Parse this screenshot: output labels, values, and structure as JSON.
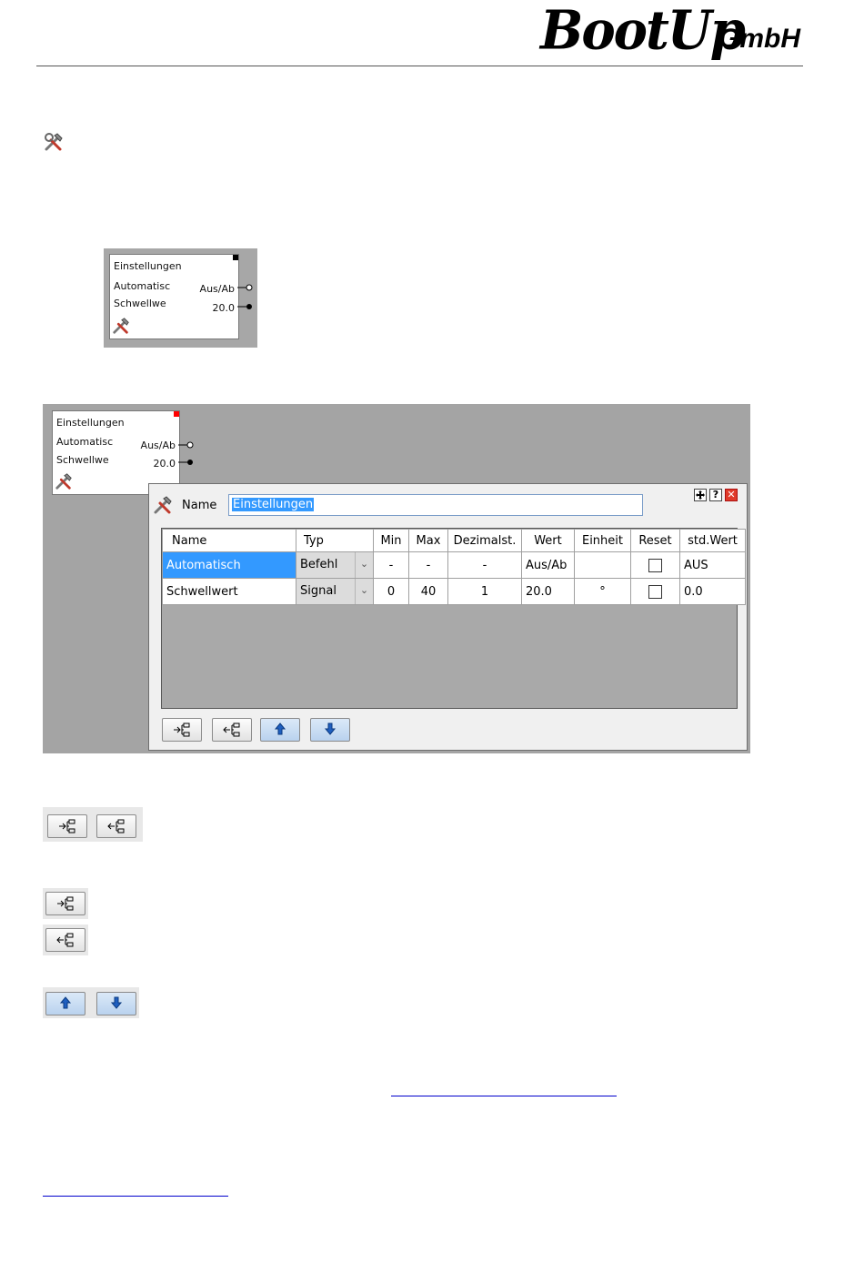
{
  "header": {
    "logo_main": "BootUp",
    "logo_sub": "GmbH"
  },
  "block_preview": {
    "title": "Einstellungen",
    "input1": "Automatisc",
    "input2": "Schwellwe",
    "output1": "Aus/Ab",
    "output2": "20.0"
  },
  "dialog_block": {
    "title": "Einstellungen",
    "input1": "Automatisc",
    "input2": "Schwellwe",
    "output1": "Aus/Ab",
    "output2": "20.0"
  },
  "dialog": {
    "name_label": "Name",
    "name_value": "Einstellungen",
    "window_buttons": [
      "move-icon",
      "help-icon",
      "close-icon"
    ],
    "columns": [
      "Name",
      "Typ",
      "Min",
      "Max",
      "Dezimalst.",
      "Wert",
      "Einheit",
      "Reset",
      "std.Wert"
    ],
    "rows": [
      {
        "name": "Automatisch",
        "typ": "Befehl",
        "min": "-",
        "max": "-",
        "dezimal": "-",
        "wert": "Aus/Ab",
        "einheit": "",
        "reset": false,
        "std_wert": "AUS"
      },
      {
        "name": "Schwellwert",
        "typ": "Signal",
        "min": "0",
        "max": "40",
        "dezimal": "1",
        "wert": "20.0",
        "einheit": "°",
        "reset": false,
        "std_wert": "0.0"
      }
    ],
    "toolbar_icons": [
      "add-input-icon",
      "add-output-icon",
      "move-up-icon",
      "move-down-icon"
    ]
  },
  "colors": {
    "selection": "#3399ff",
    "canvas": "#a4a4a4",
    "block_corner_active": "#ff0000",
    "link": "#0000cc"
  }
}
